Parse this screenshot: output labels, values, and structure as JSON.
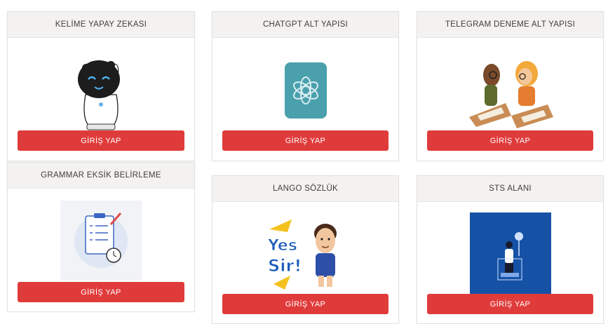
{
  "cards": [
    {
      "title": "KELİME YAPAY ZEKASI",
      "button": "GİRİŞ YAP"
    },
    {
      "title": "CHATGPT ALT YAPISI",
      "button": "GİRİŞ YAP"
    },
    {
      "title": "TELEGRAM DENEME ALT YAPISI",
      "button": "GİRİŞ YAP"
    },
    {
      "title": "GRAMMAR EKSİK BELİRLEME",
      "button": "GİRİŞ YAP"
    },
    {
      "title": "LANGO SÖZLÜK",
      "button": "GİRİŞ YAP",
      "sticker_text_1": "Yes",
      "sticker_text_2": "Sir!"
    },
    {
      "title": "STS ALANI",
      "button": "GİRİŞ YAP"
    }
  ],
  "colors": {
    "button": "#e03b3b",
    "header_bg": "#f4f2f0",
    "chatgpt_logo": "#4aa0ad",
    "sts_bg": "#1552a6",
    "yes_sir_text": "#1a5ab8",
    "yes_sir_accent": "#f4c21e"
  },
  "icons": [
    "robot-mascot-icon",
    "openai-logo-icon",
    "students-illustration-icon",
    "clipboard-checklist-icon",
    "yes-sir-boy-sticker-icon",
    "presenter-illustration-icon"
  ]
}
